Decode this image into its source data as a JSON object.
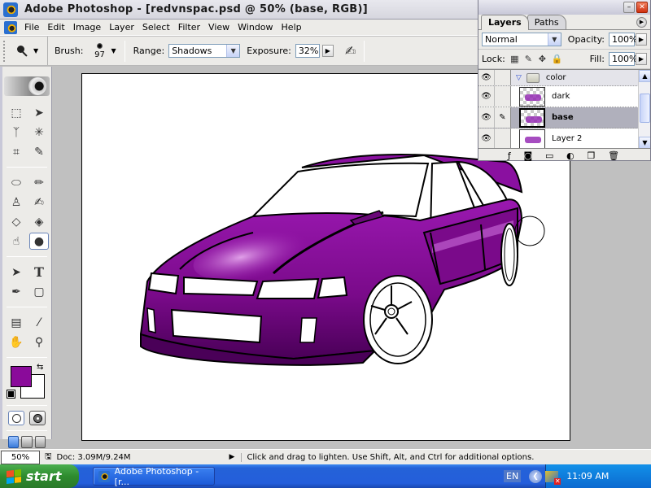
{
  "window": {
    "title": "Adobe Photoshop - [redvnspac.psd @ 50% (base, RGB)]"
  },
  "menubar": {
    "items": [
      "File",
      "Edit",
      "Image",
      "Layer",
      "Select",
      "Filter",
      "View",
      "Window",
      "Help"
    ]
  },
  "options_bar": {
    "tool": "dodge-tool",
    "brush_label": "Brush:",
    "brush_size": "97",
    "range_label": "Range:",
    "range_value": "Shadows",
    "exposure_label": "Exposure:",
    "exposure_value": "32%"
  },
  "toolbox": {
    "tools": [
      {
        "name": "marquee-tool",
        "glyph": "⬚"
      },
      {
        "name": "move-tool",
        "glyph": "➤"
      },
      {
        "name": "lasso-tool",
        "glyph": "ᛉ"
      },
      {
        "name": "magic-wand-tool",
        "glyph": "✳"
      },
      {
        "name": "crop-tool",
        "glyph": "⌗"
      },
      {
        "name": "slice-tool",
        "glyph": "✎"
      },
      {
        "name": "healing-brush-tool",
        "glyph": "⬭"
      },
      {
        "name": "brush-tool",
        "glyph": "🖌"
      },
      {
        "name": "clone-stamp-tool",
        "glyph": "⚲"
      },
      {
        "name": "history-brush-tool",
        "glyph": "✍"
      },
      {
        "name": "eraser-tool",
        "glyph": "◇"
      },
      {
        "name": "paint-bucket-tool",
        "glyph": "◈"
      },
      {
        "name": "smudge-tool",
        "glyph": "☝"
      },
      {
        "name": "dodge-tool",
        "glyph": "●",
        "active": true
      },
      {
        "name": "path-selection-tool",
        "glyph": "▲"
      },
      {
        "name": "type-tool",
        "glyph": "T"
      },
      {
        "name": "pen-tool",
        "glyph": "✒"
      },
      {
        "name": "shape-tool",
        "glyph": "▢"
      },
      {
        "name": "notes-tool",
        "glyph": "▤"
      },
      {
        "name": "eyedropper-tool",
        "glyph": "⁄"
      },
      {
        "name": "hand-tool",
        "glyph": "✋"
      },
      {
        "name": "zoom-tool",
        "glyph": "⚲"
      }
    ],
    "foreground_color": "#8a0a9a",
    "background_color": "#ffffff"
  },
  "layers_panel": {
    "tabs": [
      "Layers",
      "Paths"
    ],
    "active_tab": "Layers",
    "blend_mode": "Normal",
    "opacity_label": "Opacity:",
    "opacity_value": "100%",
    "lock_label": "Lock:",
    "fill_label": "Fill:",
    "fill_value": "100%",
    "layers": [
      {
        "name": "color",
        "type": "group",
        "visible": true,
        "expanded": true
      },
      {
        "name": "dark",
        "type": "layer",
        "visible": true,
        "selected": false
      },
      {
        "name": "base",
        "type": "layer",
        "visible": true,
        "selected": true,
        "brush_linked": true
      },
      {
        "name": "Layer 2",
        "type": "layer",
        "visible": true,
        "selected": false
      }
    ]
  },
  "status_bar": {
    "zoom": "50%",
    "doc_info": "Doc: 3.09M/9.24M",
    "message": "Click and drag to lighten. Use Shift, Alt, and Ctrl for additional options."
  },
  "taskbar": {
    "start_label": "start",
    "task_label": "Adobe Photoshop - [r...",
    "language": "EN",
    "clock": "11:09 AM"
  },
  "canvas": {
    "subject": "purple car line-art illustration",
    "body_color": "#8a0a9a",
    "shadow_color": "#5a0060",
    "highlight_color": "#d890e0"
  }
}
